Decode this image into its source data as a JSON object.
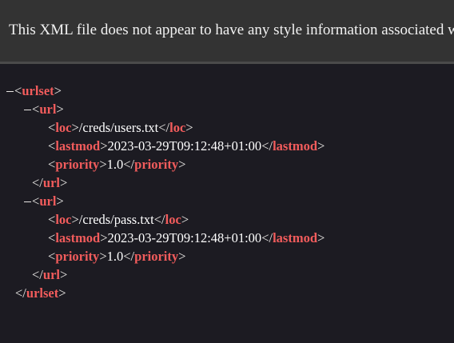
{
  "info_message": "This XML file does not appear to have any style information associated with it. The document tree is shown below.",
  "xml": {
    "root_tag": "urlset",
    "urls": [
      {
        "tag": "url",
        "loc_tag": "loc",
        "loc": "/creds/users.txt",
        "lastmod_tag": "lastmod",
        "lastmod": "2023-03-29T09:12:48+01:00",
        "priority_tag": "priority",
        "priority": "1.0"
      },
      {
        "tag": "url",
        "loc_tag": "loc",
        "loc": "/creds/pass.txt",
        "lastmod_tag": "lastmod",
        "lastmod": "2023-03-29T09:12:48+01:00",
        "priority_tag": "priority",
        "priority": "1.0"
      }
    ]
  },
  "colors": {
    "tag": "#f25c5c",
    "background": "#1c1b22",
    "info_bar": "#333333"
  }
}
